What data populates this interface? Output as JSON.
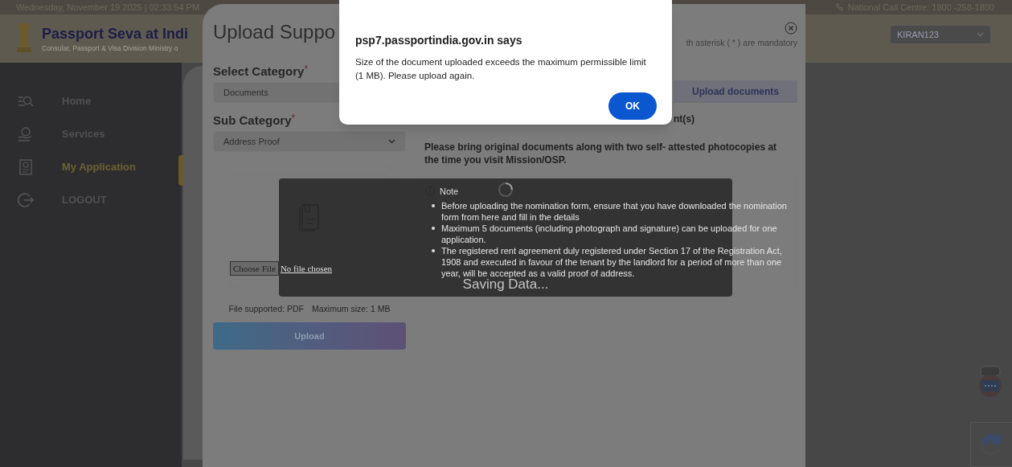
{
  "top_bar": {
    "date_time": "Wednesday, November 19 2025 | 02:33:54 PM",
    "call_centre": "National Call Centre: 1800 -258-1800"
  },
  "header": {
    "title": "Passport Seva at Indi",
    "subtitle": "Consular, Passport & Visa Division Ministry o"
  },
  "user_select": {
    "value": "KIRAN123"
  },
  "sidebar": {
    "items": [
      {
        "label": "Home",
        "selected": false
      },
      {
        "label": "Services",
        "selected": false
      },
      {
        "label": "My Application",
        "selected": true
      },
      {
        "label": "LOGOUT",
        "selected": false
      }
    ]
  },
  "modal": {
    "title": "Upload Suppo",
    "mandatory_note": "th asterisk ( * ) are mandatory",
    "tab": "Upload documents",
    "heading_fragment": "nt(s)",
    "fields": [
      {
        "kind": "text",
        "label": "Select Category",
        "marker": "*",
        "value": "Documents"
      },
      {
        "kind": "select",
        "label": "Sub Category",
        "marker": "*",
        "value": "Address Proof"
      }
    ],
    "file_input": {
      "button": "Choose File",
      "status": "No file chosen"
    },
    "file_info": [
      "File supported: PDF",
      "Maximum size: 1 MB"
    ],
    "upload_button": "Upload",
    "instructions": "Please bring original documents along with two self- attested photocopies at the time you visit Mission/OSP.",
    "note": {
      "title": "Note",
      "items": [
        "Before uploading the nomination form, ensure that you have downloaded the nomination form from here and fill in the details",
        "Maximum 5 documents (including photograph and signature) can be uploaded for one application.",
        "The registered rent agreement duly registered under Section 17 of the Registration Act, 1908 and executed in favour of the tenant by the landlord for a period of more than one year, will be accepted as a valid proof of address."
      ]
    }
  },
  "loader": {
    "text": "Saving Data..."
  },
  "alert": {
    "origin": "psp7.passportindia.gov.in says",
    "message": "Size of the document uploaded exceeds the maximum permissible limit (1 MB). Please upload again.",
    "button": "OK"
  }
}
